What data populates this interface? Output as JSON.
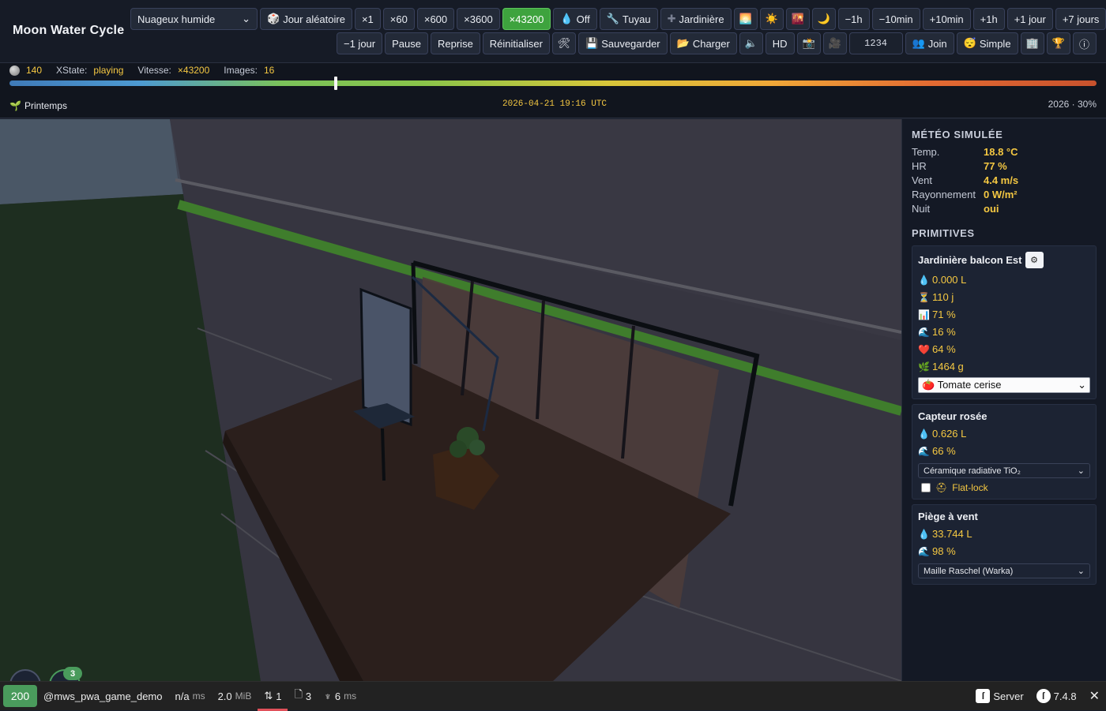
{
  "app": {
    "title": "Moon Water Cycle"
  },
  "toolbar": {
    "weather_select": "Nuageux humide",
    "random_day": "Jour aléatoire",
    "speeds": [
      "×1",
      "×60",
      "×600",
      "×3600",
      "×43200"
    ],
    "active_speed": "×43200",
    "water_toggle": "Off",
    "pipe": "Tuyau",
    "planter": "Jardinière",
    "step_back_hour": "−1h",
    "step_back_10min": "−10min",
    "step_fwd_10min": "+10min",
    "step_fwd_hour": "+1h",
    "step_fwd_day": "+1 jour",
    "step_fwd_week": "+7 jours",
    "step_back_day": "−1 jour",
    "pause": "Pause",
    "resume": "Reprise",
    "reset": "Réinitialiser",
    "save": "Sauvegarder",
    "load": "Charger",
    "hd": "HD",
    "seed": "1234",
    "join": "Join",
    "simple": "Simple"
  },
  "stats": {
    "moon_value": "140",
    "xstate_label": "XState:",
    "xstate_value": "playing",
    "speed_label": "Vitesse:",
    "speed_value": "×43200",
    "frames_label": "Images:",
    "frames_value": "16"
  },
  "timeline": {
    "progress": 0.3
  },
  "season": {
    "label": "Printemps",
    "datetime": "2026-04-21 19:16 UTC",
    "year_progress": "2026 · 30%"
  },
  "weather": {
    "title": "MÉTÉO SIMULÉE",
    "rows": [
      {
        "k": "Temp.",
        "v": "18.8 °C"
      },
      {
        "k": "HR",
        "v": "77 %"
      },
      {
        "k": "Vent",
        "v": "4.4 m/s"
      },
      {
        "k": "Rayonnement",
        "v": "0 W/m²"
      },
      {
        "k": "Nuit",
        "v": "oui"
      }
    ]
  },
  "primitives": {
    "title": "PRIMITIVES",
    "planter": {
      "title": "Jardinière balcon Est",
      "water": "0.000 L",
      "age": "110 j",
      "growth": "71 %",
      "moisture": "16 %",
      "health": "64 %",
      "biomass": "1464 g",
      "crop": "Tomate cerise"
    },
    "dew": {
      "title": "Capteur rosée",
      "water": "0.626 L",
      "moisture": "66 %",
      "material": "Céramique radiative TiO₂",
      "flatlock": "Flat-lock"
    },
    "wind": {
      "title": "Piège à vent",
      "water": "33.744 L",
      "moisture": "98 %",
      "mesh": "Maille Raschel (Warka)"
    }
  },
  "badges": {
    "count": "3"
  },
  "debugbar": {
    "status": "200",
    "route": "@mws_pwa_game_demo",
    "time": "n/a",
    "time_unit": "ms",
    "memory": "2.0",
    "memory_unit": "MiB",
    "requests": "1",
    "files": "3",
    "twig": "6",
    "twig_unit": "ms",
    "server": "Server",
    "version": "7.4.8"
  },
  "colors": {
    "accent": "#3ea33e",
    "value": "#f5c842",
    "panel": "#141925"
  }
}
